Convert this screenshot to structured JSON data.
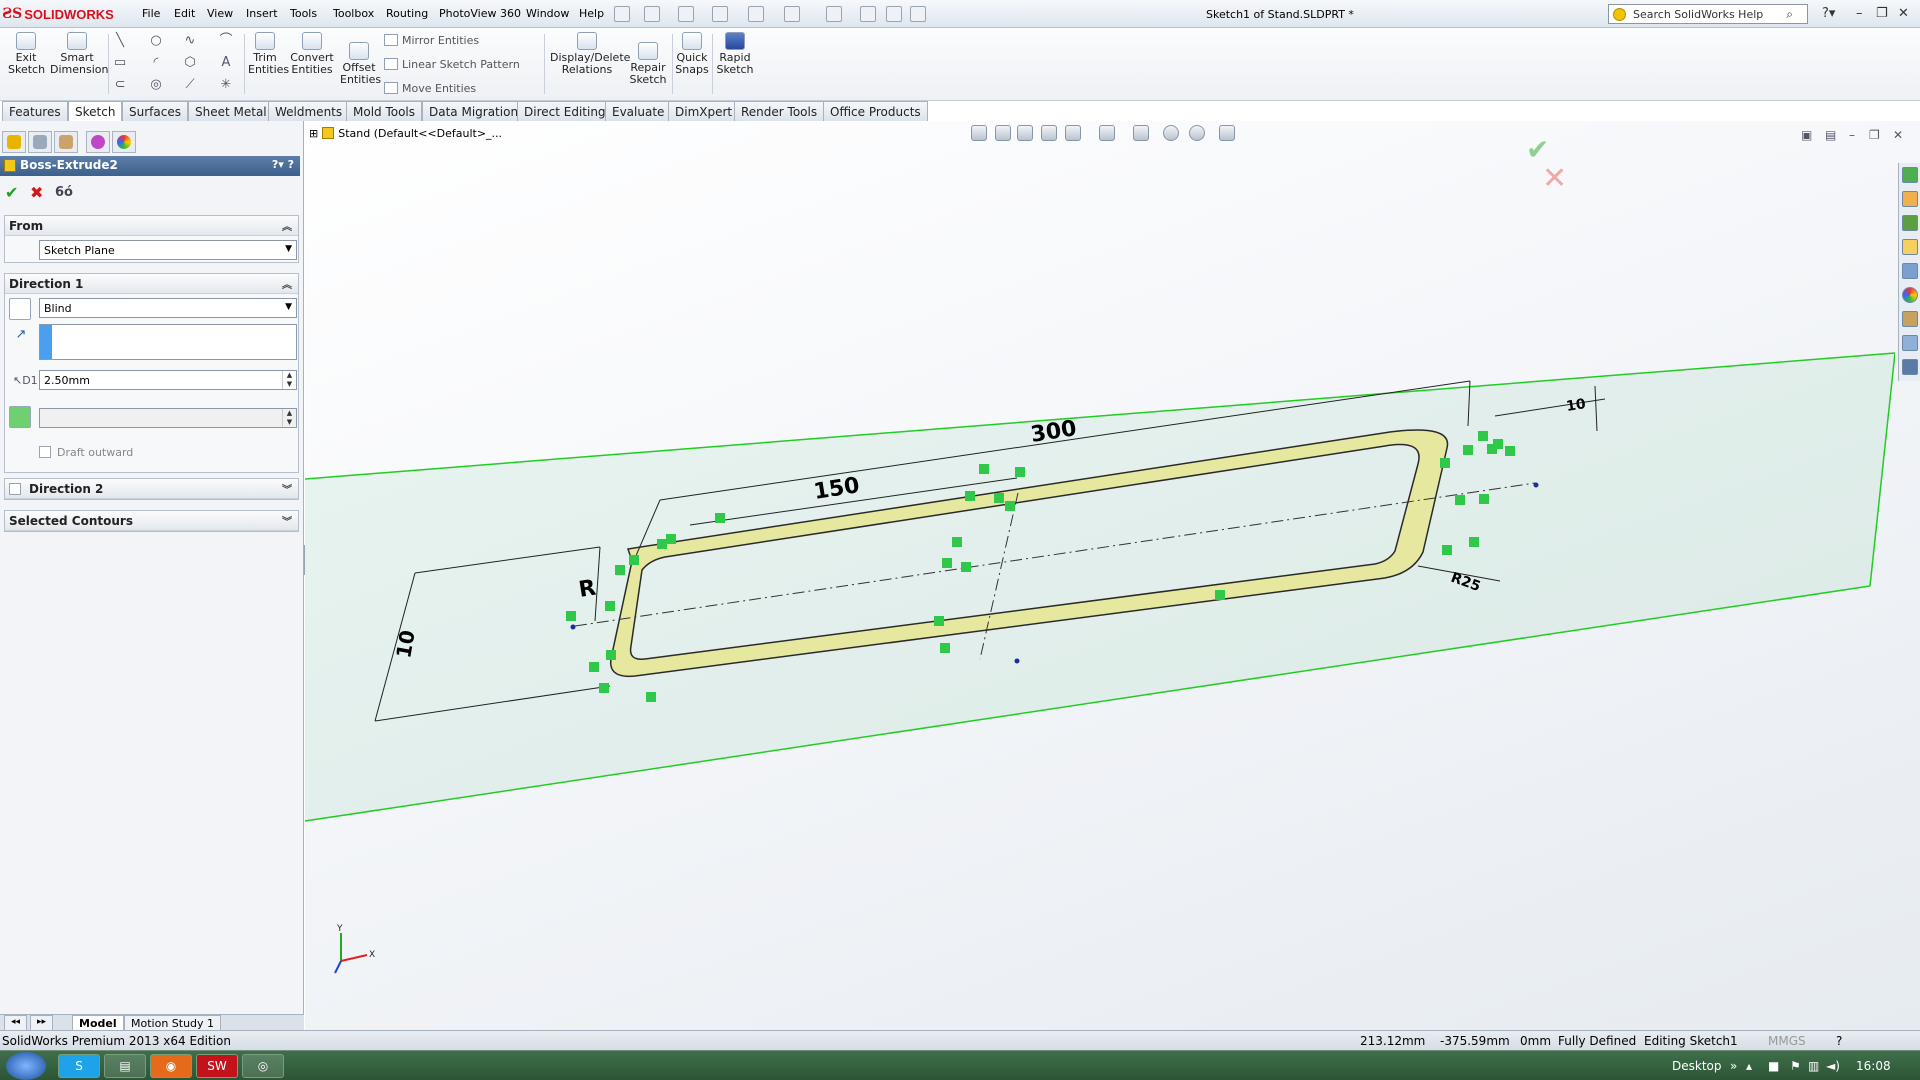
{
  "app": {
    "logo_text": "SOLIDWORKS",
    "document_title": "Sketch1 of Stand.SLDPRT *",
    "menu": [
      "File",
      "Edit",
      "View",
      "Insert",
      "Tools",
      "Toolbox",
      "Routing",
      "PhotoView 360",
      "Window",
      "Help"
    ],
    "search_placeholder": "Search SolidWorks Help"
  },
  "ribbon": {
    "exit_sketch": "Exit\nSketch",
    "smart_dimension": "Smart\nDimension",
    "trim_entities": "Trim\nEntities",
    "convert_entities": "Convert\nEntities",
    "offset_entities": "Offset\nEntities",
    "mirror_entities": "Mirror Entities",
    "linear_sketch_pattern": "Linear Sketch Pattern",
    "move_entities": "Move Entities",
    "display_delete_relations": "Display/Delete\nRelations",
    "repair_sketch": "Repair\nSketch",
    "quick_snaps": "Quick\nSnaps",
    "rapid_sketch": "Rapid\nSketch"
  },
  "tabs": [
    "Features",
    "Sketch",
    "Surfaces",
    "Sheet Metal",
    "Weldments",
    "Mold Tools",
    "Data Migration",
    "Direct Editing",
    "Evaluate",
    "DimXpert",
    "Render Tools",
    "Office Products"
  ],
  "active_tab": "Sketch",
  "property_manager": {
    "title": "Boss-Extrude2",
    "from_label": "From",
    "from_value": "Sketch Plane",
    "direction1_label": "Direction 1",
    "end_condition": "Blind",
    "depth": "2.50mm",
    "draft_outward": "Draft outward",
    "direction2_label": "Direction 2",
    "selected_contours_label": "Selected Contours"
  },
  "feature_tree": {
    "root": "Stand  (Default<<Default>_..."
  },
  "sketch": {
    "dim_300": "300",
    "dim_150": "150",
    "dim_r": "R",
    "dim_left": "10",
    "dim_right_small": "R25",
    "dim_top_right": "10"
  },
  "bottom_tabs": [
    "Model",
    "Motion Study 1"
  ],
  "status": {
    "edition": "SolidWorks Premium 2013 x64 Edition",
    "x": "213.12mm",
    "y": "-375.59mm",
    "z": "0mm",
    "state": "Fully Defined",
    "editing": "Editing Sketch1",
    "units": "MMGS"
  },
  "taskbar": {
    "desktop_label": "Desktop",
    "clock": "16:08"
  },
  "colors": {
    "brand_red": "#d8101c",
    "plane_green": "#22cc22",
    "sketch_yellow": "#e6e8a0",
    "relation_green": "#2fc84a"
  }
}
